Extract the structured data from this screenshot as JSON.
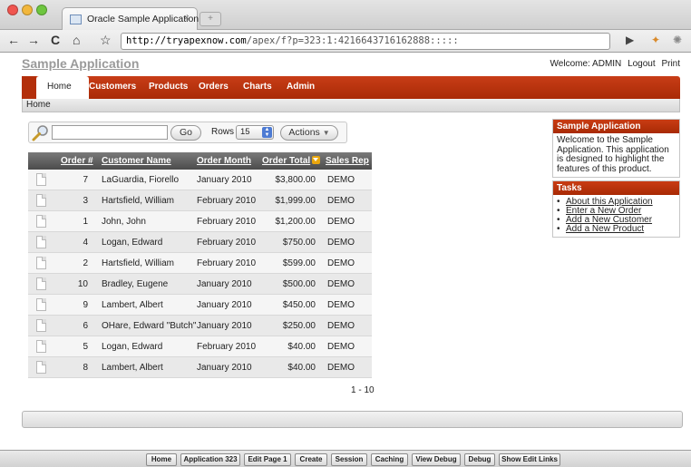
{
  "browser": {
    "tab_title": "Oracle Sample Application",
    "tab_close": "×",
    "new_tab": "+",
    "url_host": "http://tryapexnow.com",
    "url_path": "/apex/f?p=323:1:4216643716162888:::::",
    "back_icon": "←",
    "forward_icon": "→",
    "reload_icon": "C",
    "home_icon": "⌂",
    "star_icon": "☆",
    "play_icon": "▶",
    "wrench_icon": "✦",
    "gear_icon": "✺"
  },
  "header": {
    "app_title": "Sample Application",
    "welcome": "Welcome: ADMIN",
    "logout": "Logout",
    "print": "Print"
  },
  "tabs": [
    "Home",
    "Customers",
    "Products",
    "Orders",
    "Charts",
    "Admin"
  ],
  "breadcrumb": "Home",
  "toolbar": {
    "search_value": "",
    "go_label": "Go",
    "rows_label": "Rows",
    "rows_value": "15",
    "actions_label": "Actions"
  },
  "report": {
    "columns": [
      "Order #",
      "Customer Name",
      "Order Month",
      "Order Total",
      "Sales Rep"
    ],
    "rows": [
      {
        "order": "7",
        "customer": "LaGuardia, Fiorello",
        "month": "January 2010",
        "total": "$3,800.00",
        "rep": "DEMO"
      },
      {
        "order": "3",
        "customer": "Hartsfield, William",
        "month": "February 2010",
        "total": "$1,999.00",
        "rep": "DEMO"
      },
      {
        "order": "1",
        "customer": "John, John",
        "month": "February 2010",
        "total": "$1,200.00",
        "rep": "DEMO"
      },
      {
        "order": "4",
        "customer": "Logan, Edward",
        "month": "February 2010",
        "total": "$750.00",
        "rep": "DEMO"
      },
      {
        "order": "2",
        "customer": "Hartsfield, William",
        "month": "February 2010",
        "total": "$599.00",
        "rep": "DEMO"
      },
      {
        "order": "10",
        "customer": "Bradley, Eugene",
        "month": "January 2010",
        "total": "$500.00",
        "rep": "DEMO"
      },
      {
        "order": "9",
        "customer": "Lambert, Albert",
        "month": "January 2010",
        "total": "$450.00",
        "rep": "DEMO"
      },
      {
        "order": "6",
        "customer": "OHare, Edward \"Butch\"",
        "month": "January 2010",
        "total": "$250.00",
        "rep": "DEMO"
      },
      {
        "order": "5",
        "customer": "Logan, Edward",
        "month": "February 2010",
        "total": "$40.00",
        "rep": "DEMO"
      },
      {
        "order": "8",
        "customer": "Lambert, Albert",
        "month": "January 2010",
        "total": "$40.00",
        "rep": "DEMO"
      }
    ],
    "pagination": "1 - 10"
  },
  "sidebar": {
    "info_title": "Sample Application",
    "info_text": "Welcome to the Sample Application. This application is designed to highlight the features of this product.",
    "tasks_title": "Tasks",
    "tasks": [
      "About this Application",
      "Enter a New Order",
      "Add a New Customer",
      "Add a New Product"
    ]
  },
  "devbar": [
    "Home",
    "Application 323",
    "Edit Page 1",
    "Create",
    "Session",
    "Caching",
    "View Debug",
    "Debug",
    "Show Edit Links"
  ],
  "colors": {
    "accent": "#b73109",
    "header_gray": "#5c5c5c",
    "sort_icon": "#e9a60d"
  }
}
